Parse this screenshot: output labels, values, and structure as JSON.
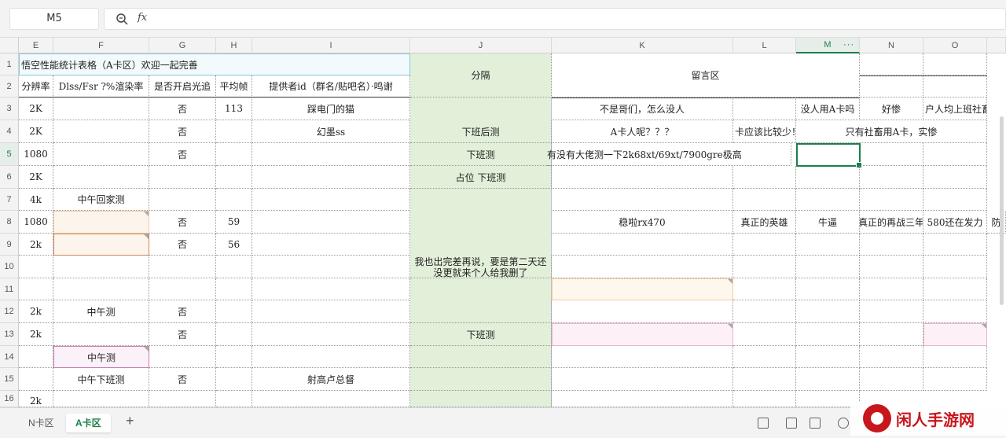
{
  "formula_bar": {
    "name_box": "M5",
    "fx_label": "fx"
  },
  "columns": [
    "E",
    "F",
    "G",
    "H",
    "I",
    "J",
    "K",
    "L",
    "M",
    "N",
    "O"
  ],
  "selected_column": "M",
  "col_menu": "···",
  "rows": [
    "1",
    "2",
    "3",
    "4",
    "5",
    "6",
    "7",
    "8",
    "9",
    "10",
    "11",
    "12",
    "13",
    "14",
    "15",
    "16"
  ],
  "selected_row": "5",
  "header_row1": {
    "title": "悟空性能统计表格（A卡区）欢迎一起完善",
    "divider": "分隔",
    "comments": "留言区"
  },
  "header_row2": [
    "分辨率",
    "Dlss/Fsr ?%渲染率",
    "是否开启光追",
    "平均帧",
    "提供者id（群名/贴吧名）·鸣谢"
  ],
  "cells": {
    "r3": {
      "E": "2K",
      "G": "否",
      "H": "113",
      "I": "踩电门的猫",
      "K": "不是哥们，怎么没人",
      "M": "没人用A卡吗",
      "N": "好惨",
      "O": "户人均上班社畜是"
    },
    "r4": {
      "E": "2K",
      "G": "否",
      "I": "幻墨ss",
      "J": "下班后测",
      "K": "A卡人呢？？？",
      "L": "卡应该比较少！",
      "MN": "只有社畜用A卡，实惨"
    },
    "r5": {
      "E": "1080",
      "G": "否",
      "J": "下班测",
      "K": "有没有大佬测一下2k68xt/69xt/7900gre极高"
    },
    "r6": {
      "E": "2K",
      "J": "占位 下班测"
    },
    "r7": {
      "E": "4k",
      "F": "中午回家测"
    },
    "r8": {
      "E": "1080",
      "G": "否",
      "H": "59",
      "K": "稳啦rx470",
      "L": "真正的英雄",
      "M": "牛逼",
      "N": "真正的再战三年",
      "O": "580还在发力",
      "P": "防"
    },
    "r9": {
      "E": "2k",
      "G": "否",
      "H": "56"
    },
    "r10": {
      "J": "我也出完差再说，要是第二天还没更就来个人给我删了"
    },
    "r12": {
      "E": "2k",
      "F": "中午测",
      "G": "否"
    },
    "r13": {
      "E": "2k",
      "G": "否",
      "J": "下班测"
    },
    "r14": {
      "F": "中午测"
    },
    "r15": {
      "F": "中午下班测",
      "G": "否",
      "I": "射高卢总督"
    },
    "r16": {
      "E": "2k"
    }
  },
  "sheet_tabs": [
    {
      "label": "N卡区",
      "active": false
    },
    {
      "label": "A卡区",
      "active": true
    }
  ],
  "add_sheet": "+",
  "watermark": "闲人手游网",
  "colors": {
    "accent": "#1a7f4b",
    "divider_fill": "#e2efd9",
    "watermark": "#c8161d"
  }
}
